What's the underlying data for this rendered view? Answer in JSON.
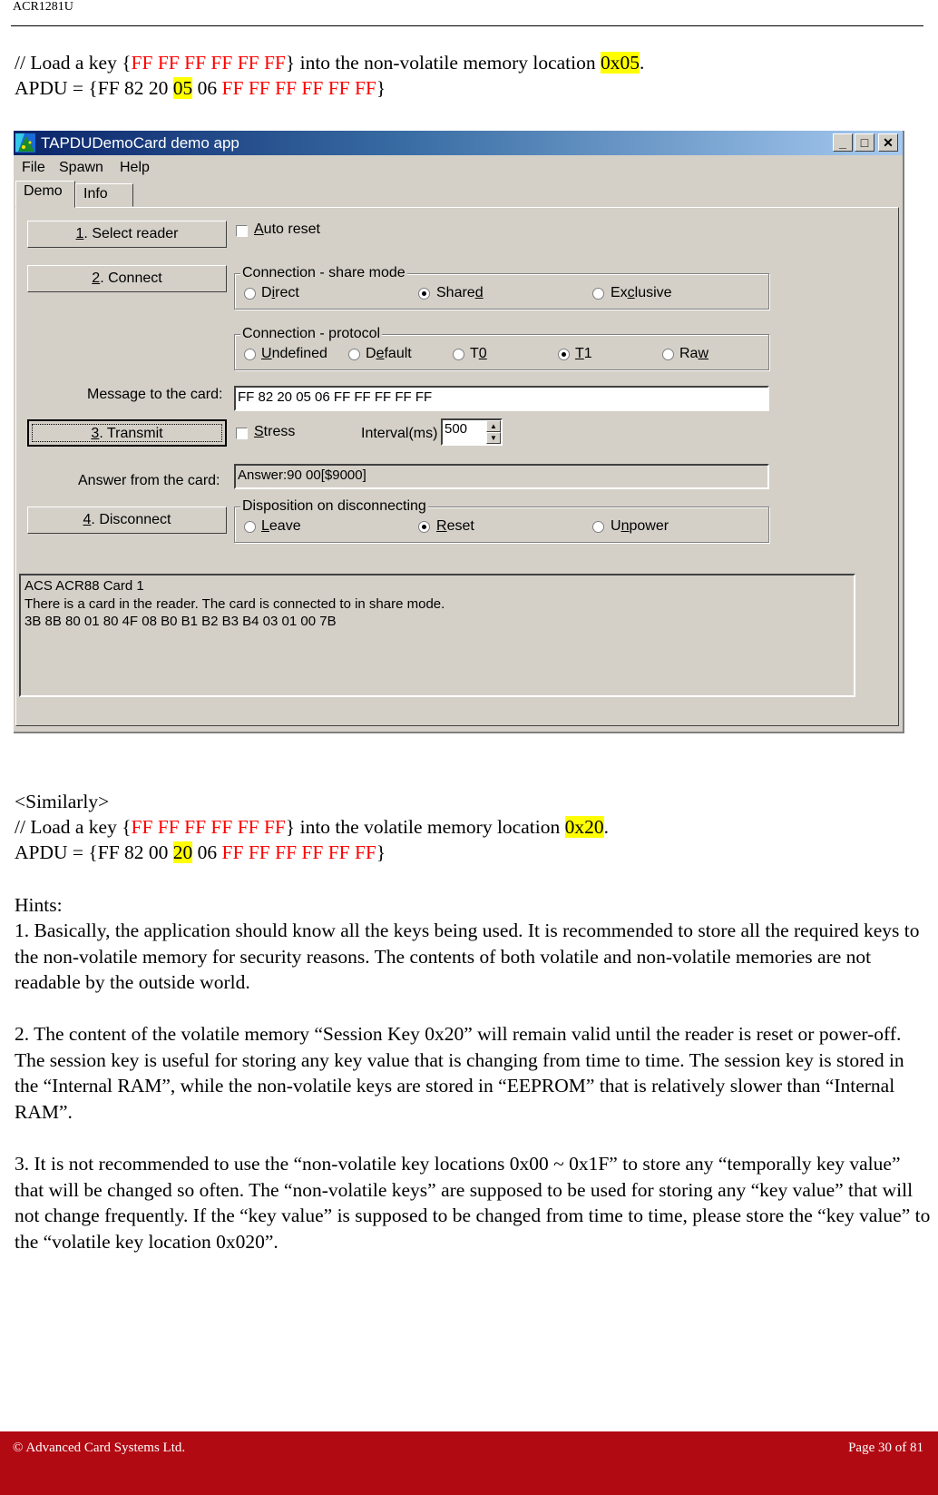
{
  "header": {
    "doc_id": "ACR1281U"
  },
  "intro": {
    "line1": {
      "prefix": "// Load a key {",
      "key": "FF FF FF FF FF FF",
      "middle": "} into the non-volatile memory location ",
      "location": "0x05",
      "suffix": "."
    },
    "line2": {
      "prefix": "APDU = {FF 82 20 ",
      "slot": "05",
      "mid": " 06 ",
      "key": "FF FF FF FF FF FF",
      "suffix": "}"
    }
  },
  "app": {
    "title": "TAPDUDemoCard demo app",
    "title_buttons": {
      "minimize": "_",
      "maximize": "□",
      "close": "✕"
    },
    "menu": [
      "File",
      "Spawn",
      "Help"
    ],
    "tabs": [
      {
        "label": "Demo",
        "active": true
      },
      {
        "label": "Info",
        "active": false
      }
    ],
    "buttons": {
      "select_reader": {
        "mnemonic": "1",
        "label": ". Select reader"
      },
      "connect": {
        "mnemonic": "2",
        "label": ". Connect"
      },
      "transmit": {
        "mnemonic": "3",
        "label": ". Transmit"
      },
      "disconnect": {
        "mnemonic": "4",
        "label": ". Disconnect"
      }
    },
    "auto_reset": {
      "mnemonic": "A",
      "label": "uto reset",
      "checked": false
    },
    "share_mode": {
      "title": "Connection - share mode",
      "options": [
        {
          "pre": "D",
          "u": "i",
          "post": "rect",
          "selected": false
        },
        {
          "pre": "Share",
          "u": "d",
          "post": "",
          "selected": true
        },
        {
          "pre": "Ex",
          "u": "c",
          "post": "lusive",
          "selected": false
        }
      ]
    },
    "protocol": {
      "title": "Connection - protocol",
      "options": [
        {
          "pre": "",
          "u": "U",
          "post": "ndefined",
          "selected": false
        },
        {
          "pre": "D",
          "u": "e",
          "post": "fault",
          "selected": false
        },
        {
          "pre": "T",
          "u": "0",
          "post": "",
          "selected": false
        },
        {
          "pre": "",
          "u": "T",
          "post": "1",
          "selected": true
        },
        {
          "pre": "Ra",
          "u": "w",
          "post": "",
          "selected": false
        }
      ]
    },
    "message_label": "Message to the card:",
    "message_value": "FF 82 20 05 06 FF FF FF FF FF",
    "stress": {
      "mnemonic": "S",
      "label": "tress",
      "checked": false
    },
    "interval_label": "Interval(ms)",
    "interval_value": "500",
    "answer_label": "Answer from the card:",
    "answer_value": "Answer:90 00[$9000]",
    "disposition": {
      "title": "Disposition on disconnecting",
      "options": [
        {
          "pre": "",
          "u": "L",
          "post": "eave",
          "selected": false
        },
        {
          "pre": "",
          "u": "R",
          "post": "eset",
          "selected": true
        },
        {
          "pre": "U",
          "u": "n",
          "post": "power",
          "selected": false
        }
      ]
    },
    "log_lines": [
      "ACS ACR88 Card 1",
      "There is a card in the reader. The card is connected to in share mode.",
      "3B 8B 80 01 80 4F 08 B0 B1 B2 B3 B4 03 01 00 7B"
    ]
  },
  "similarly": {
    "heading": "<Similarly>",
    "line1": {
      "prefix": "// Load a key {",
      "key": "FF FF FF FF FF FF",
      "middle": "} into the volatile memory location ",
      "location": "0x20",
      "suffix": "."
    },
    "line2": {
      "prefix": "APDU = {FF 82 00 ",
      "slot": "20",
      "mid": " 06 ",
      "key": "FF FF FF FF FF FF",
      "suffix": "}"
    }
  },
  "hints": {
    "heading": "Hints:",
    "items": [
      "1. Basically, the application should know all the keys being used. It is recommended to store all the required keys to the non-volatile memory for security reasons. The contents of both volatile and non-volatile memories are not readable by the outside world.",
      "2. The content of the volatile memory “Session Key 0x20” will remain valid until the reader is reset or power-off. The session key is useful for storing any key value that is changing from time to time. The session key is stored in the “Internal RAM”, while the non-volatile keys are stored in “EEPROM” that is relatively slower than “Internal RAM”.",
      "3. It is not recommended to use the “non-volatile key locations 0x00 ~ 0x1F” to store any “temporally key value” that will be changed so often. The “non-volatile keys” are supposed to be used for storing any “key value” that will not change frequently. If the “key value” is supposed to be changed from time to time, please store the “key value” to the “volatile key location 0x020”."
    ]
  },
  "footer": {
    "copyright": "© Advanced Card Systems Ltd.",
    "page": "Page 30 of 81"
  },
  "colors": {
    "key_red": "#ff0000",
    "highlight": "#ffff00",
    "footer_bg": "#b20a13",
    "dialog_bg": "#d4d0c8"
  }
}
